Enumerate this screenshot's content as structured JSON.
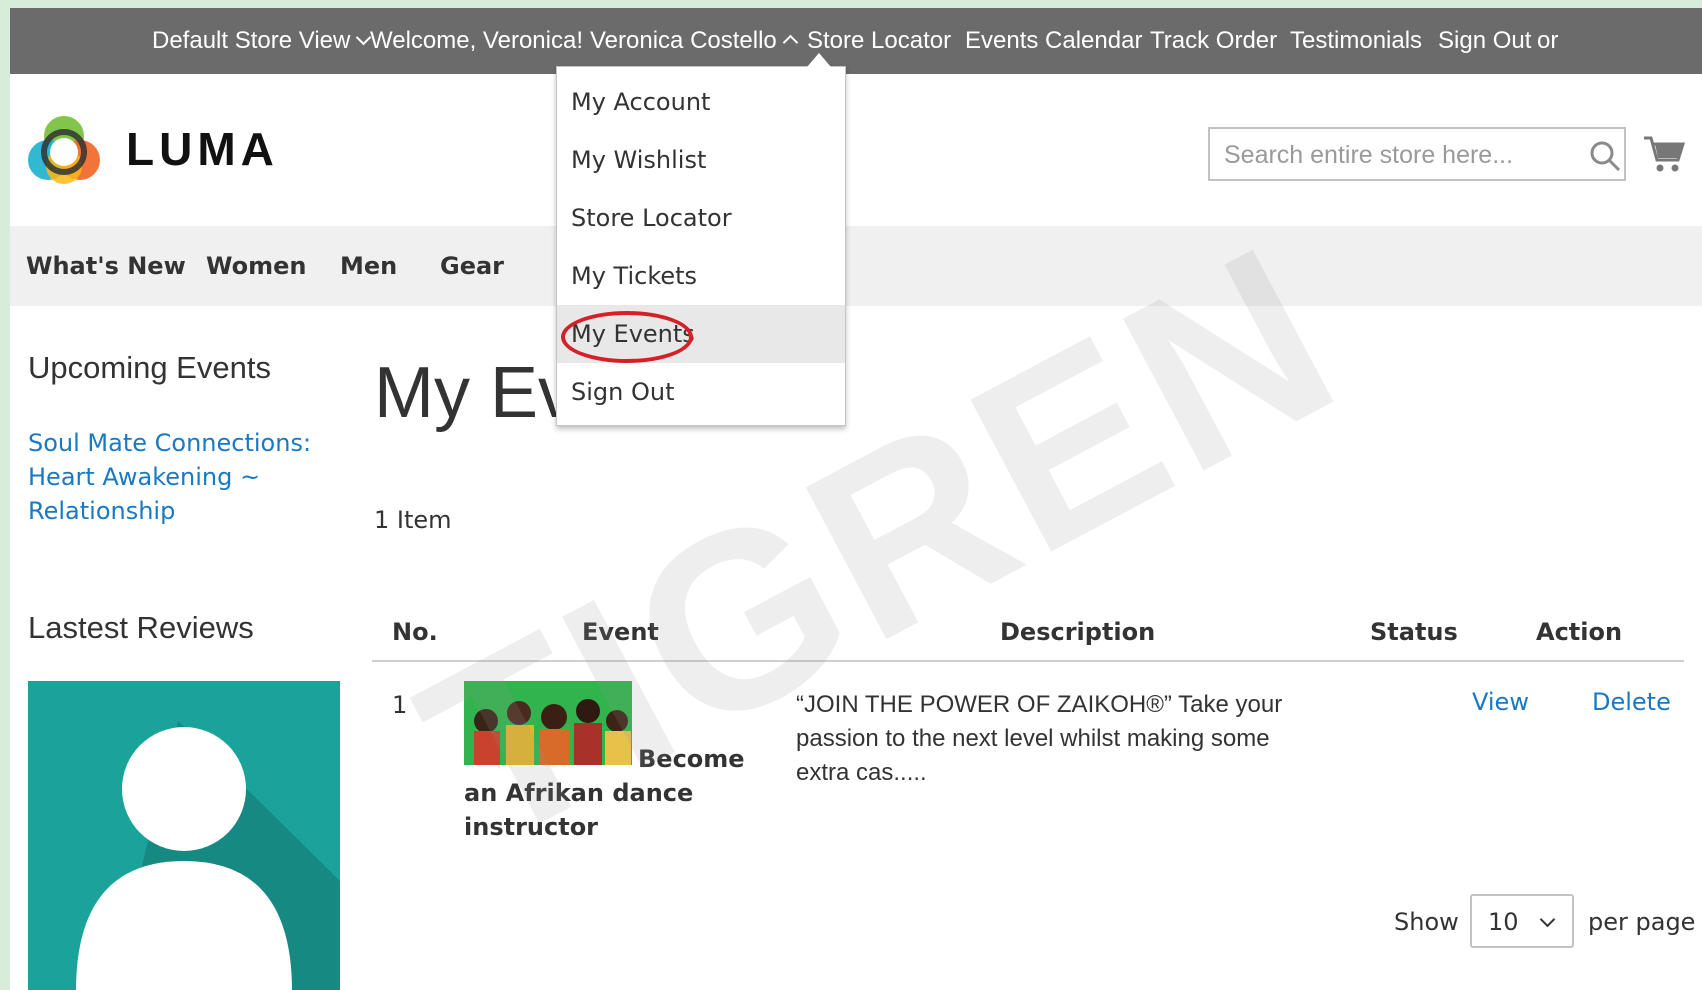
{
  "top_bar": {
    "store_view": "Default Store View",
    "welcome": "Welcome, Veronica!",
    "account_name": "Veronica Costello",
    "links": [
      "Store Locator",
      "Events Calendar",
      "Track Order",
      "Testimonials",
      "Sign Out",
      "or"
    ],
    "background": "#6b6b6b"
  },
  "account_menu": {
    "items": [
      "My Account",
      "My Wishlist",
      "Store Locator",
      "My Tickets",
      "My Events",
      "Sign Out"
    ],
    "highlighted": "My Events",
    "highlight_color": "#d61f26"
  },
  "header": {
    "logo_text": "LUMA",
    "search_placeholder": "Search entire store here..."
  },
  "nav": {
    "items": [
      "What's New",
      "Women",
      "Men",
      "Gear"
    ]
  },
  "sidebar": {
    "upcoming_title": "Upcoming Events",
    "upcoming_link": "Soul Mate Connections: Heart Awakening ~ Relationship",
    "reviews_title": "Lastest Reviews"
  },
  "main": {
    "title": "My Events",
    "item_count": "1 Item",
    "columns": [
      "No.",
      "Event",
      "Description",
      "Status",
      "Action"
    ],
    "rows": [
      {
        "no": "1",
        "event": "Become an Afrikan dance instructor",
        "description": "“JOIN THE POWER OF ZAIKOH®” Take your passion to the next level whilst making some extra cas.....",
        "status": "",
        "actions": [
          "View",
          "Delete"
        ]
      }
    ],
    "pager": {
      "show_label": "Show",
      "per_page_value": "10",
      "per_page_label": "per page"
    }
  },
  "watermark": "TIGREN",
  "colors": {
    "link": "#1979c3",
    "accent_teal": "#1aa39a"
  }
}
